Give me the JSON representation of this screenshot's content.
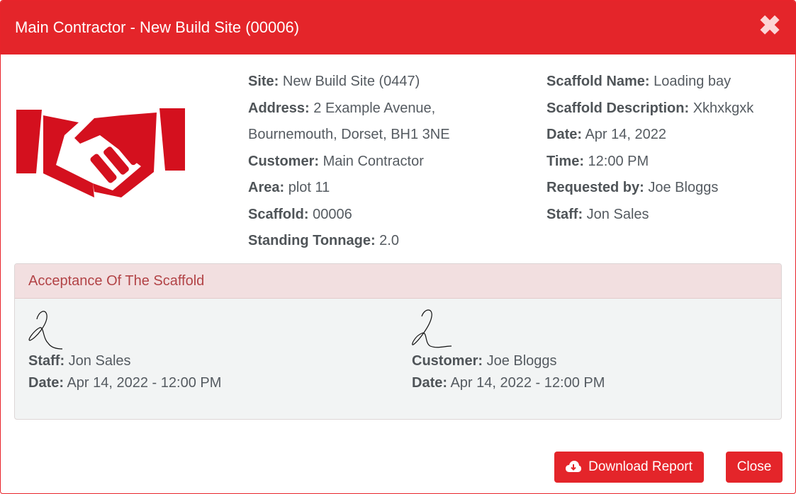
{
  "modal": {
    "title": "Main Contractor - New Build Site (00006)",
    "close_symbol": "✖"
  },
  "details_left": [
    {
      "label": "Site:",
      "value": "New Build Site (0447)"
    },
    {
      "label": "Address:",
      "value": "2 Example Avenue,"
    },
    {
      "label": "",
      "value": "Bournemouth, Dorset, BH1 3NE"
    },
    {
      "label": "Customer:",
      "value": "Main Contractor"
    },
    {
      "label": "Area:",
      "value": "plot 11"
    },
    {
      "label": "Scaffold:",
      "value": "00006"
    },
    {
      "label": "Standing Tonnage:",
      "value": "2.0"
    }
  ],
  "details_right": [
    {
      "label": "Scaffold Name:",
      "value": "Loading bay"
    },
    {
      "label": "Scaffold Description:",
      "value": "Xkhxkgxk"
    },
    {
      "label": "Date:",
      "value": "Apr 14, 2022"
    },
    {
      "label": "Time:",
      "value": "12:00 PM"
    },
    {
      "label": "Requested by:",
      "value": "Joe Bloggs"
    },
    {
      "label": "Staff:",
      "value": "Jon Sales"
    }
  ],
  "acceptance": {
    "heading": "Acceptance Of The Scaffold",
    "staff": {
      "name_label": "Staff:",
      "name": "Jon Sales",
      "date_label": "Date:",
      "date": "Apr 14, 2022 - 12:00 PM"
    },
    "customer": {
      "name_label": "Customer:",
      "name": "Joe Bloggs",
      "date_label": "Date:",
      "date": "Apr 14, 2022 - 12:00 PM"
    }
  },
  "buttons": {
    "download": "Download Report",
    "close": "Close"
  },
  "icons": {
    "logo": "handshake-icon",
    "download": "cloud-download-icon",
    "close": "close-icon"
  },
  "colors": {
    "accent": "#e4252a",
    "panel_header_bg": "#f2dfe0",
    "panel_header_text": "#b24346"
  }
}
